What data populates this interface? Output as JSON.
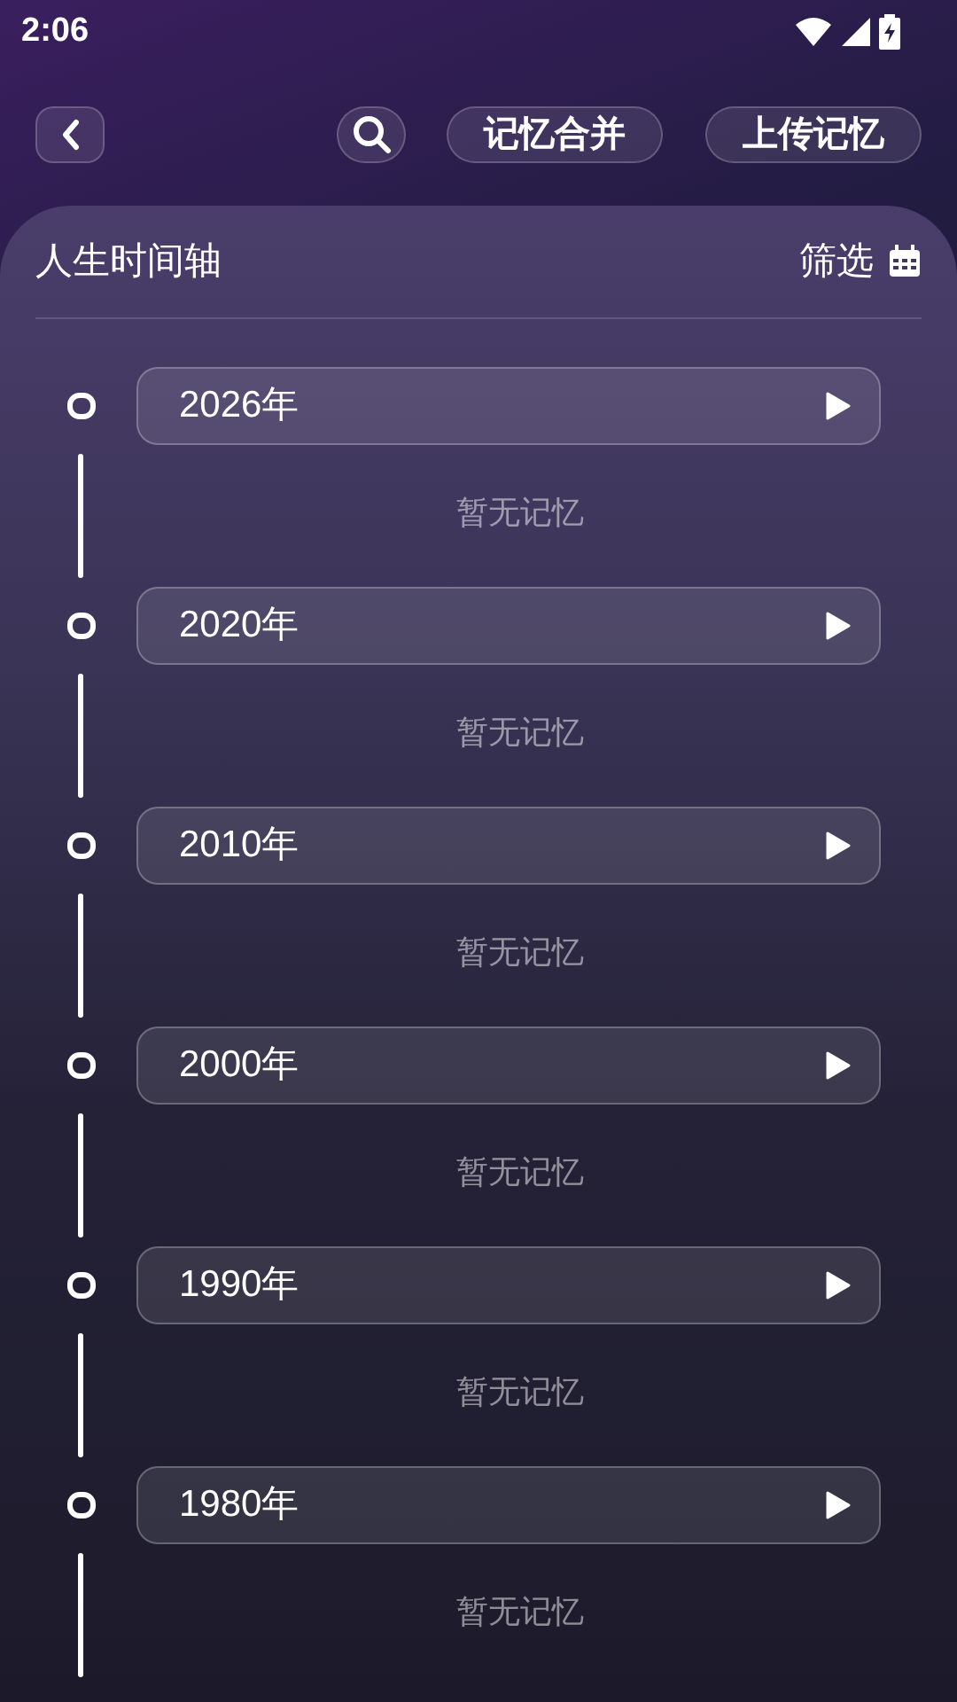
{
  "status_bar": {
    "time": "2:06"
  },
  "header": {
    "actions": [
      "记忆合并",
      "上传记忆"
    ]
  },
  "timeline": {
    "title": "人生时间轴",
    "filter": "筛选",
    "items": [
      {
        "year": "2026年",
        "note": "暂无记忆"
      },
      {
        "year": "2020年",
        "note": "暂无记忆"
      },
      {
        "year": "2010年",
        "note": "暂无记忆"
      },
      {
        "year": "2000年",
        "note": "暂无记忆"
      },
      {
        "year": "1990年",
        "note": "暂无记忆"
      },
      {
        "year": "1980年",
        "note": "暂无记忆"
      }
    ]
  }
}
